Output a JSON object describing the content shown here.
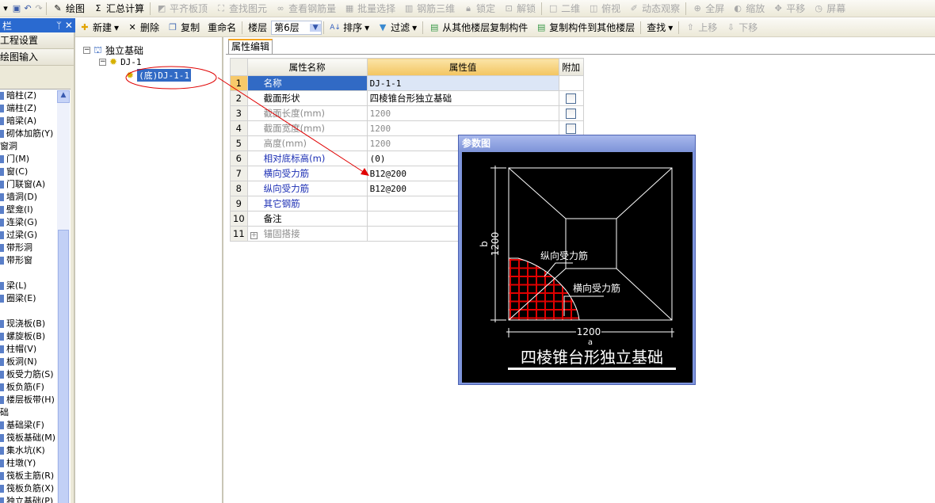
{
  "toolbar1": {
    "items": [
      {
        "label": "绘图",
        "icon": "draw-icon",
        "enabled": true
      },
      {
        "label": "汇总计算",
        "icon": "sigma-icon",
        "enabled": true
      },
      {
        "label": "平齐板顶",
        "icon": "align-icon",
        "enabled": false
      },
      {
        "label": "查找图元",
        "icon": "binoculars-icon",
        "enabled": false
      },
      {
        "label": "查看钢筋量",
        "icon": "rebar-icon",
        "enabled": false
      },
      {
        "label": "批量选择",
        "icon": "batch-icon",
        "enabled": false
      },
      {
        "label": "钢筋三维",
        "icon": "3d-icon",
        "enabled": false
      },
      {
        "label": "锁定",
        "icon": "lock-icon",
        "enabled": false
      },
      {
        "label": "解锁",
        "icon": "unlock-icon",
        "enabled": false
      },
      {
        "label": "二维",
        "icon": "2d-icon",
        "enabled": false
      },
      {
        "label": "俯视",
        "icon": "cube-icon",
        "enabled": false
      },
      {
        "label": "动态观察",
        "icon": "orbit-icon",
        "enabled": false
      },
      {
        "label": "全屏",
        "icon": "zoom-icon",
        "enabled": false
      },
      {
        "label": "缩放",
        "icon": "scale-icon",
        "enabled": false
      },
      {
        "label": "平移",
        "icon": "pan-icon",
        "enabled": false
      },
      {
        "label": "屏幕",
        "icon": "screen-icon",
        "enabled": false
      }
    ]
  },
  "toolbar2": {
    "new": "新建",
    "delete": "删除",
    "copy": "复制",
    "rename": "重命名",
    "floor_label": "楼层",
    "floor_value": "第6层",
    "sort": "排序",
    "filter": "过滤",
    "copy_from": "从其他楼层复制构件",
    "copy_to": "复制构件到其他楼层",
    "find": "查找",
    "move_up": "上移",
    "move_down": "下移"
  },
  "left_panel": {
    "title": "栏",
    "sections": [
      "工程设置",
      "绘图输入"
    ],
    "items": [
      {
        "label": "暗柱(Z)"
      },
      {
        "label": "端柱(Z)"
      },
      {
        "label": "暗梁(A)"
      },
      {
        "label": "砌体加筋(Y)"
      },
      {
        "label": "窗洞",
        "group": true
      },
      {
        "label": "门(M)"
      },
      {
        "label": "窗(C)"
      },
      {
        "label": "门联窗(A)"
      },
      {
        "label": "墙洞(D)"
      },
      {
        "label": "壁龛(I)"
      },
      {
        "label": "连梁(G)"
      },
      {
        "label": "过梁(G)"
      },
      {
        "label": "带形洞"
      },
      {
        "label": "带形窗"
      },
      {
        "label": "",
        "group": true
      },
      {
        "label": "梁(L)"
      },
      {
        "label": "圈梁(E)"
      },
      {
        "label": "",
        "group": true
      },
      {
        "label": "现浇板(B)"
      },
      {
        "label": "螺旋板(B)"
      },
      {
        "label": "柱帽(V)"
      },
      {
        "label": "板洞(N)"
      },
      {
        "label": "板受力筋(S)"
      },
      {
        "label": "板负筋(F)"
      },
      {
        "label": "楼层板带(H)"
      },
      {
        "label": "础",
        "group": true
      },
      {
        "label": "基础梁(F)"
      },
      {
        "label": "筏板基础(M)"
      },
      {
        "label": "集水坑(K)"
      },
      {
        "label": "柱墩(Y)"
      },
      {
        "label": "筏板主筋(R)"
      },
      {
        "label": "筏板负筋(X)"
      },
      {
        "label": "独立基础(P)"
      }
    ]
  },
  "tree": {
    "root": "独立基础",
    "child": "DJ-1",
    "leaf": "(底)DJ-1-1"
  },
  "props": {
    "tab": "属性编辑",
    "headers": [
      "属性名称",
      "属性值",
      "附加"
    ],
    "rows": [
      {
        "n": "1",
        "name": "名称",
        "value": "DJ-1-1",
        "style": "sel",
        "check": false
      },
      {
        "n": "2",
        "name": "截面形状",
        "value": "四棱锥台形独立基础",
        "style": "",
        "check": true
      },
      {
        "n": "3",
        "name": "截面长度(mm)",
        "value": "1200",
        "style": "gray",
        "check": true
      },
      {
        "n": "4",
        "name": "截面宽度(mm)",
        "value": "1200",
        "style": "gray",
        "check": true
      },
      {
        "n": "5",
        "name": "高度(mm)",
        "value": "1200",
        "style": "gray",
        "check": false
      },
      {
        "n": "6",
        "name": "相对底标高(m)",
        "value": "(0)",
        "style": "blue",
        "check": false
      },
      {
        "n": "7",
        "name": "横向受力筋",
        "value": "B12@200",
        "style": "blue",
        "check": false
      },
      {
        "n": "8",
        "name": "纵向受力筋",
        "value": "B12@200",
        "style": "blue",
        "check": false
      },
      {
        "n": "9",
        "name": "其它钢筋",
        "value": "",
        "style": "blue",
        "check": false
      },
      {
        "n": "10",
        "name": "备注",
        "value": "",
        "style": "",
        "check": false
      },
      {
        "n": "11",
        "name": "锚固搭接",
        "value": "",
        "style": "gray",
        "check": false,
        "expand": "+"
      }
    ]
  },
  "param_dialog": {
    "title": "参数图",
    "dim_b": "1200",
    "label_b": "b",
    "dim_a": "1200",
    "label_a": "a",
    "label_long": "纵向受力筋",
    "label_trans": "横向受力筋",
    "caption": "四棱锥台形独立基础"
  },
  "colors": {
    "selection": "#316ac5",
    "annotation": "#e00000",
    "rebar": "#e00000"
  }
}
